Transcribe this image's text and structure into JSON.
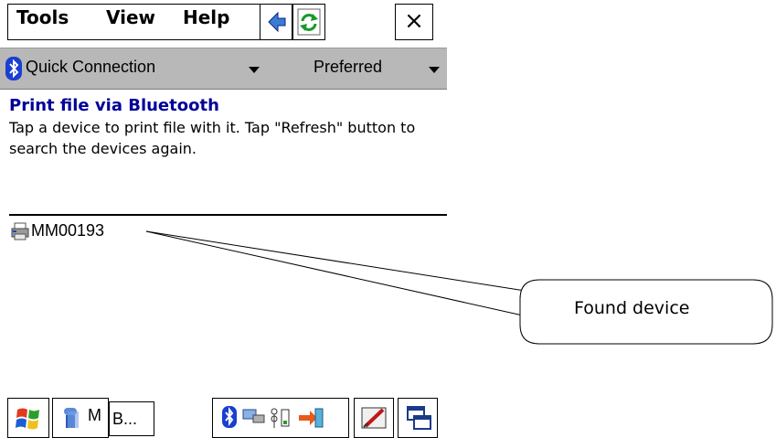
{
  "menubar": {
    "items": [
      "Tools",
      "View",
      "Help"
    ],
    "close_label": "×"
  },
  "cmdbar": {
    "connection": "Quick Connection",
    "mode": "Preferred"
  },
  "page": {
    "heading": "Print file via Bluetooth",
    "description": "Tap a device to print file with it. Tap \"Refresh\" button to search the devices again."
  },
  "devices": [
    {
      "name": "MM00193",
      "icon": "printer-icon"
    }
  ],
  "taskbar": {
    "task_text": "B...",
    "letter_fragment": "M"
  },
  "callout": {
    "label": "Found device"
  },
  "colors": {
    "heading": "#000099",
    "cmdbar_bg": "#b8b8b8",
    "bluetooth": "#1a3fd1"
  }
}
